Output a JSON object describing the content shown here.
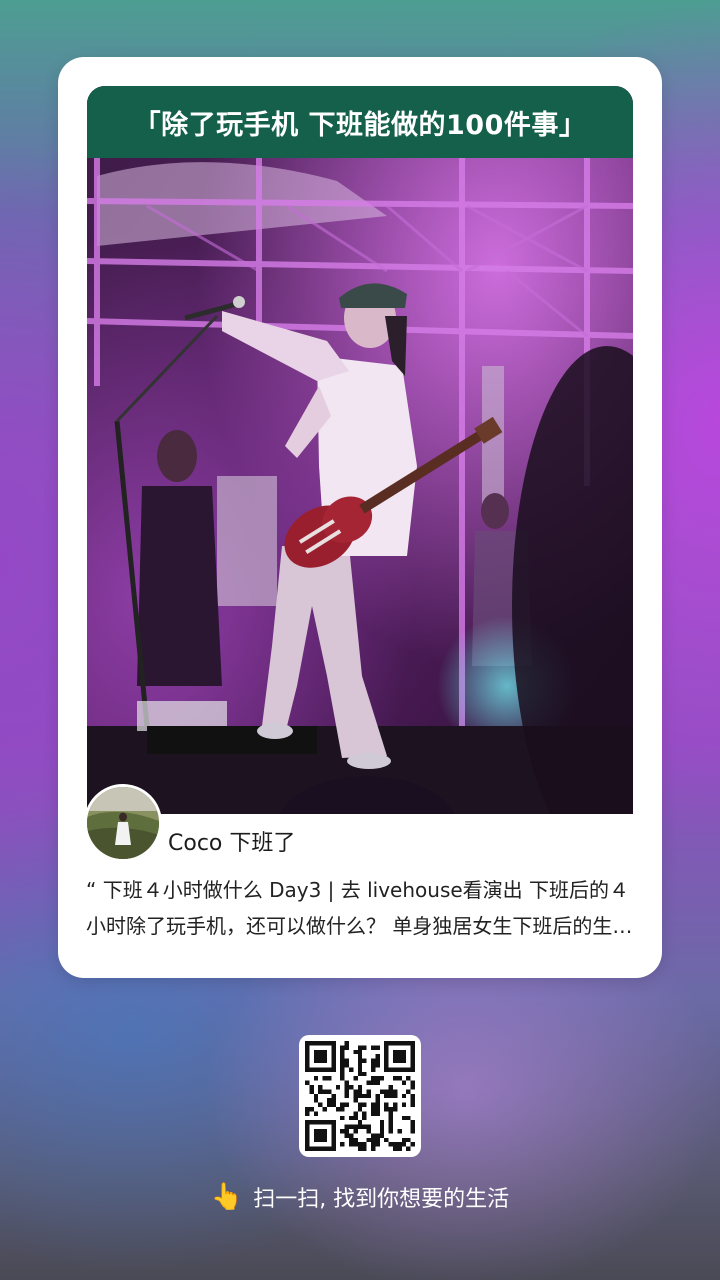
{
  "card": {
    "banner_title": "「除了玩手机 下班能做的100件事」",
    "author_name": "Coco 下班了",
    "description": "“ 下班４小时做什么 Day3 | 去 livehouse看演出 下班后的４小时除了玩手机，还可以做什么？ 单身独居女生下班后的生活记录"
  },
  "footer": {
    "scan_icon": "pointing-hand-icon",
    "scan_text": "扫一扫, 找到你想要的生活"
  },
  "colors": {
    "banner_bg": "#15604b",
    "card_bg": "#ffffff",
    "text_primary": "#1c1c1c"
  }
}
